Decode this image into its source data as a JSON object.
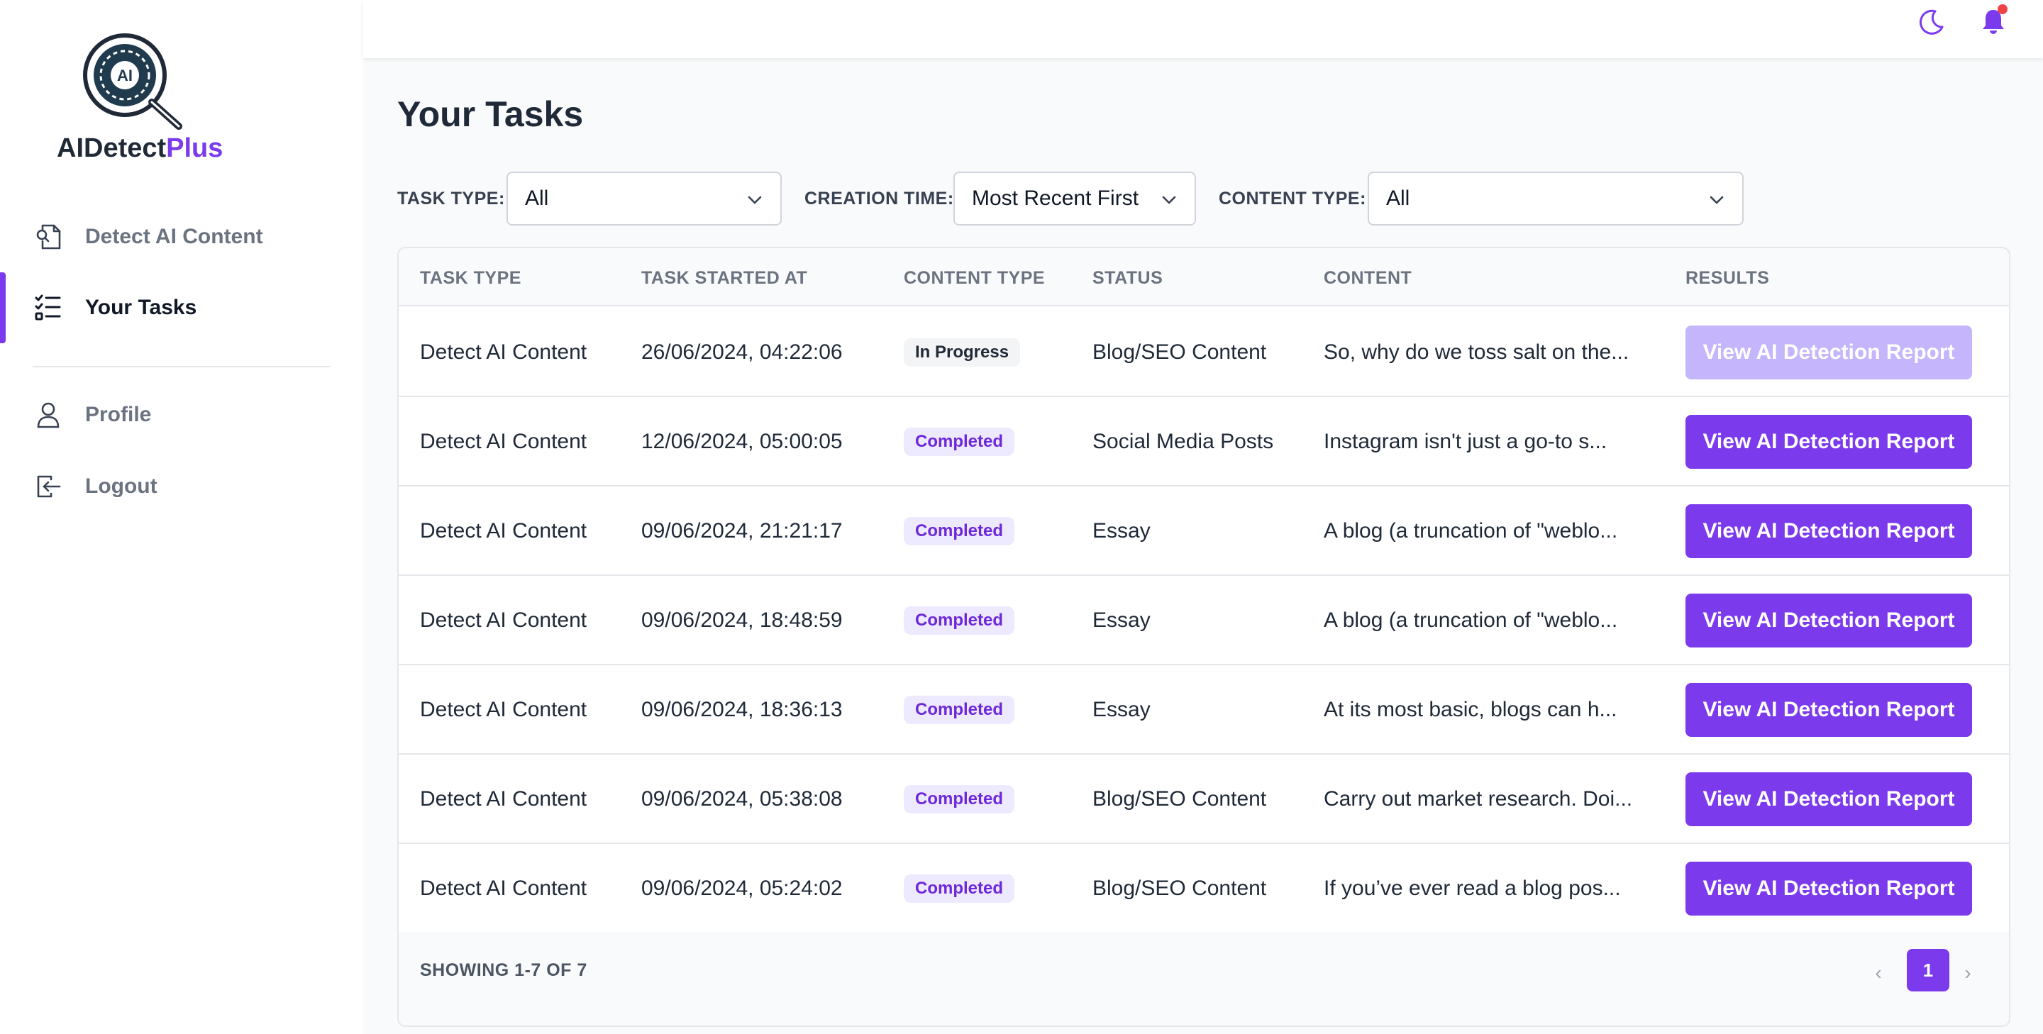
{
  "brand": {
    "name_main": "AIDetect",
    "name_accent": "Plus",
    "logo_text": "AI",
    "accent_color": "#7c3aed"
  },
  "sidebar": {
    "items": [
      {
        "label": "Detect AI Content",
        "icon": "document-scan-icon",
        "active": false
      },
      {
        "label": "Your Tasks",
        "icon": "task-list-icon",
        "active": true
      },
      {
        "label": "Profile",
        "icon": "user-icon",
        "active": false
      },
      {
        "label": "Logout",
        "icon": "logout-icon",
        "active": false
      }
    ]
  },
  "topbar": {
    "icons": [
      "moon-icon",
      "bell-icon"
    ]
  },
  "page": {
    "title": "Your Tasks"
  },
  "filters": {
    "task_type": {
      "label": "TASK TYPE:",
      "value": "All"
    },
    "creation_time": {
      "label": "CREATION TIME:",
      "value": "Most Recent First"
    },
    "content_type": {
      "label": "CONTENT TYPE:",
      "value": "All"
    }
  },
  "table": {
    "headers": [
      "TASK TYPE",
      "TASK STARTED AT",
      "CONTENT TYPE",
      "STATUS",
      "CONTENT",
      "RESULTS"
    ],
    "rows": [
      {
        "task_type": "Detect AI Content",
        "started": "26/06/2024, 04:22:06",
        "status": "In Progress",
        "content_type": "Blog/SEO Content",
        "content": "So, why do we toss salt on the...",
        "action": "View AI Detection Report",
        "disabled": true
      },
      {
        "task_type": "Detect AI Content",
        "started": "12/06/2024, 05:00:05",
        "status": "Completed",
        "content_type": "Social Media Posts",
        "content": "Instagram isn't just a go-to s...",
        "action": "View AI Detection Report",
        "disabled": false
      },
      {
        "task_type": "Detect AI Content",
        "started": "09/06/2024, 21:21:17",
        "status": "Completed",
        "content_type": "Essay",
        "content": "A blog (a truncation of \"weblo...",
        "action": "View AI Detection Report",
        "disabled": false
      },
      {
        "task_type": "Detect AI Content",
        "started": "09/06/2024, 18:48:59",
        "status": "Completed",
        "content_type": "Essay",
        "content": "A blog (a truncation of \"weblo...",
        "action": "View AI Detection Report",
        "disabled": false
      },
      {
        "task_type": "Detect AI Content",
        "started": "09/06/2024, 18:36:13",
        "status": "Completed",
        "content_type": "Essay",
        "content": "At its most basic, blogs can h...",
        "action": "View AI Detection Report",
        "disabled": false
      },
      {
        "task_type": "Detect AI Content",
        "started": "09/06/2024, 05:38:08",
        "status": "Completed",
        "content_type": "Blog/SEO Content",
        "content": "Carry out market research. Doi...",
        "action": "View AI Detection Report",
        "disabled": false
      },
      {
        "task_type": "Detect AI Content",
        "started": "09/06/2024, 05:24:02",
        "status": "Completed",
        "content_type": "Blog/SEO Content",
        "content": "If you’ve ever read a blog pos...",
        "action": "View AI Detection Report",
        "disabled": false
      }
    ]
  },
  "pagination": {
    "summary": "SHOWING 1-7 OF 7",
    "current_page": "1",
    "prev": "‹",
    "next": "›"
  }
}
